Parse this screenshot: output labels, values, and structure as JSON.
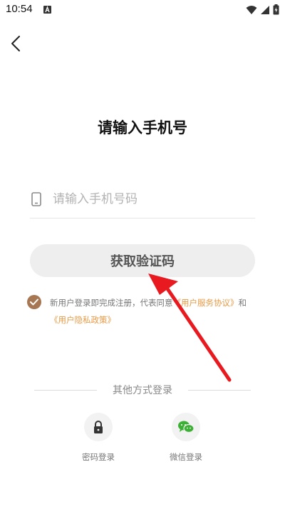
{
  "status_bar": {
    "time": "10:54"
  },
  "title": "请输入手机号",
  "phone_input": {
    "placeholder": "请输入手机号码",
    "value": ""
  },
  "get_code_button": "获取验证码",
  "agreement": {
    "prefix": "新用户登录即完成注册，代表同意",
    "terms_link": "《用户服务协议》",
    "and": "和",
    "privacy_link": "《用户隐私政策》"
  },
  "other_methods": {
    "divider_text": "其他方式登录",
    "password_login": "密码登录",
    "wechat_login": "微信登录"
  },
  "colors": {
    "accent": "#a77753",
    "link": "#e69a45",
    "button_bg": "#eeeeee",
    "annotation_arrow": "#e8191f"
  }
}
